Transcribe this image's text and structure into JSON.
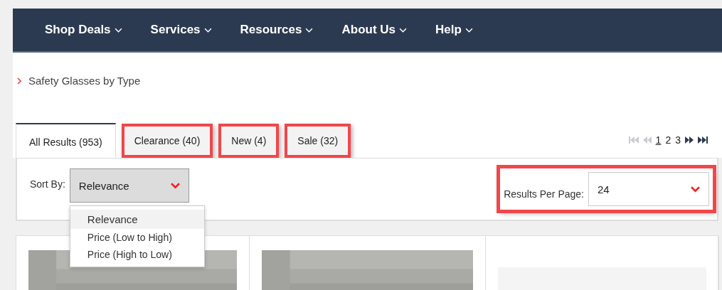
{
  "nav": [
    {
      "label": "Shop Deals"
    },
    {
      "label": "Services"
    },
    {
      "label": "Resources"
    },
    {
      "label": "About Us"
    },
    {
      "label": "Help"
    }
  ],
  "breadcrumb": "Safety Glasses by Type",
  "tabs": [
    {
      "label": "All Results (953)",
      "selected": true,
      "highlighted": false
    },
    {
      "label": "Clearance (40)",
      "selected": false,
      "highlighted": true
    },
    {
      "label": "New (4)",
      "selected": false,
      "highlighted": true
    },
    {
      "label": "Sale (32)",
      "selected": false,
      "highlighted": true
    }
  ],
  "pagination": {
    "first_disabled": true,
    "prev_disabled": true,
    "pages": [
      {
        "label": "1",
        "selected": true
      },
      {
        "label": "2",
        "selected": false
      },
      {
        "label": "3",
        "selected": false
      }
    ]
  },
  "sort": {
    "label": "Sort By:",
    "value": "Relevance",
    "expanded": true,
    "options": [
      {
        "label": "Relevance",
        "selected": true
      },
      {
        "label": "Price (Low to High)",
        "selected": false
      },
      {
        "label": "Price (High to Low)",
        "selected": false
      }
    ]
  },
  "per_page": {
    "label": "Results Per Page:",
    "value": "24",
    "highlighted": true
  }
}
